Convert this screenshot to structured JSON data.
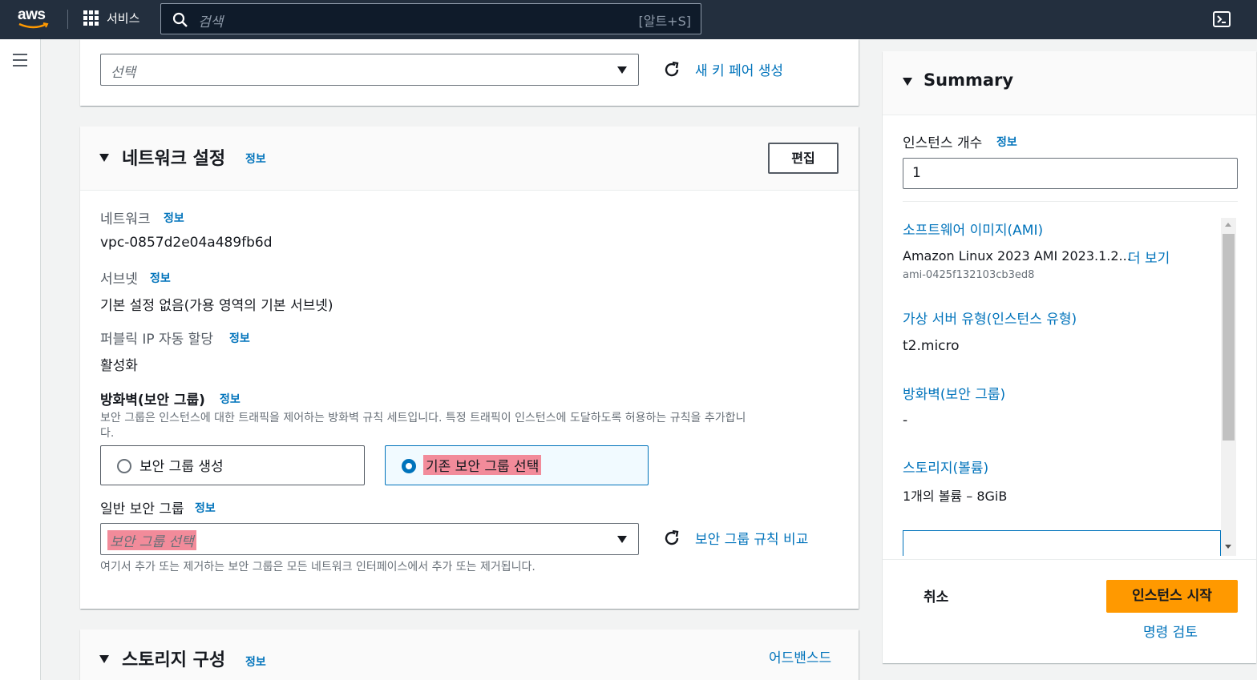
{
  "topnav": {
    "logo_text": "aws",
    "services_label": "서비스",
    "search_placeholder": "검색",
    "search_shortcut": "[알트+S]"
  },
  "keypair": {
    "select_value": "선택",
    "create_link": "새 키 페어 생성"
  },
  "network": {
    "title": "네트워크 설정",
    "info": "정보",
    "edit_button": "편집",
    "network_label": "네트워크",
    "network_value": "vpc-0857d2e04a489fb6d",
    "subnet_label": "서브넷",
    "subnet_value": "기본 설정 없음(가용 영역의 기본 서브넷)",
    "public_ip_label": "퍼블릭 IP 자동 할당",
    "public_ip_value": "활성화",
    "firewall_label": "방화벽(보안 그룹)",
    "firewall_desc_1": "보안 그룹은 인스턴스에 대한 트래픽을 제어하는 방화벽 규칙 세트입니다. 특정 트래픽이 인스턴스에 도달하도록 허용하는 규칙을 추가합니",
    "firewall_desc_2": "다.",
    "option_create": "보안 그룹 생성",
    "option_existing": "기존 보안 그룹 선택",
    "common_sg_label": "일반 보안 그룹",
    "sg_select_placeholder": "보안 그룹 선택",
    "compare_link": "보안 그룹 규칙 비교",
    "sg_hint": "여기서 추가 또는 제거하는 보안 그룹은 모든 네트워크 인터페이스에서 추가 또는 제거됩니다."
  },
  "storage": {
    "title": "스토리지 구성",
    "info": "정보",
    "advanced_link": "어드밴스드"
  },
  "summary": {
    "title": "Summary",
    "instance_count_label": "인스턴스 개수",
    "info": "정보",
    "instance_count_value": "1",
    "ami_label": "소프트웨어 이미지(AMI)",
    "ami_value": "Amazon Linux 2023 AMI 2023.1.2...",
    "ami_more": "더 보기",
    "ami_id": "ami-0425f132103cb3ed8",
    "type_label": "가상 서버 유형(인스턴스 유형)",
    "type_value": "t2.micro",
    "firewall_label": "방화벽(보안 그룹)",
    "firewall_value": "-",
    "storage_label": "스토리지(볼륨)",
    "storage_value": "1개의 볼륨 – 8GiB",
    "cancel_button": "취소",
    "launch_button": "인스턴스 시작",
    "review_link": "명령 검토"
  },
  "colors": {
    "nav_bg": "#232f3e",
    "link": "#0073bb",
    "primary": "#ff9900",
    "highlight": "#f28b9a"
  }
}
